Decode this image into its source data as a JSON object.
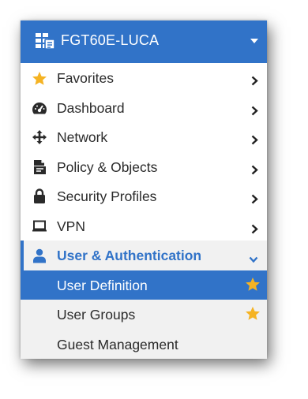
{
  "header": {
    "device_name": "FGT60E-LUCA",
    "device_icon": "fortinet-device-icon",
    "caret_icon": "caret-down-icon"
  },
  "menu": {
    "items": [
      {
        "label": "Favorites",
        "icon": "star-icon"
      },
      {
        "label": "Dashboard",
        "icon": "dashboard-gauge-icon"
      },
      {
        "label": "Network",
        "icon": "network-move-icon"
      },
      {
        "label": "Policy & Objects",
        "icon": "policy-document-icon"
      },
      {
        "label": "Security Profiles",
        "icon": "lock-icon"
      },
      {
        "label": "VPN",
        "icon": "laptop-icon"
      },
      {
        "label": "User & Authentication",
        "icon": "user-icon",
        "expanded": true
      }
    ],
    "submenu": [
      {
        "label": "User Definition",
        "active": true,
        "favorite": true
      },
      {
        "label": "User Groups",
        "active": false,
        "favorite": true
      },
      {
        "label": "Guest Management",
        "active": false,
        "favorite": false
      }
    ]
  },
  "colors": {
    "accent": "#3173c8",
    "favorite_star": "#f5b323",
    "submenu_background": "#f1f1f1",
    "text": "#2a2a2a"
  }
}
